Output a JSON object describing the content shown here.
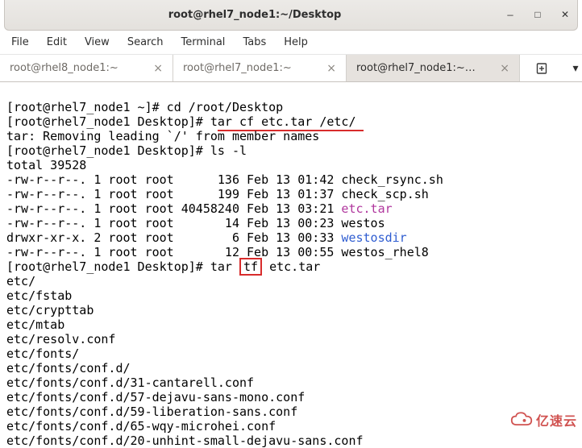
{
  "window": {
    "title": "root@rhel7_node1:~/Desktop"
  },
  "menu": {
    "file": "File",
    "edit": "Edit",
    "view": "View",
    "search": "Search",
    "terminal": "Terminal",
    "tabs": "Tabs",
    "help": "Help"
  },
  "tabs": [
    {
      "label": "root@rhel8_node1:~"
    },
    {
      "label": "root@rhel7_node1:~"
    },
    {
      "label": "root@rhel7_node1:~…"
    }
  ],
  "term": {
    "l1a": "[root@rhel7_node1 ~]# cd /root/Desktop",
    "l2a": "[root@rhel7_node1 Desktop]# t",
    "l2b": "ar cf etc.tar /etc/ ",
    "l3": "tar: Removing leading `/' from member names",
    "l4": "[root@rhel7_node1 Desktop]# ls -l",
    "l5": "total 39528",
    "l6": "-rw-r--r--. 1 root root      136 Feb 13 01:42 check_rsync.sh",
    "l7": "-rw-r--r--. 1 root root      199 Feb 13 01:37 check_scp.sh",
    "l8a": "-rw-r--r--. 1 root root 40458240 Feb 13 03:21 ",
    "l8b": "etc.tar",
    "l9": "-rw-r--r--. 1 root root       14 Feb 13 00:23 westos",
    "l10a": "drwxr-xr-x. 2 root root        6 Feb 13 00:33 ",
    "l10b": "westosdir",
    "l11": "-rw-r--r--. 1 root root       12 Feb 13 00:55 westos_rhel8",
    "l12a": "[root@rhel7_node1 Desktop]# tar ",
    "l12b": "tf",
    "l12c": " etc.tar",
    "l13": "etc/",
    "l14": "etc/fstab",
    "l15": "etc/crypttab",
    "l16": "etc/mtab",
    "l17": "etc/resolv.conf",
    "l18": "etc/fonts/",
    "l19": "etc/fonts/conf.d/",
    "l20": "etc/fonts/conf.d/31-cantarell.conf",
    "l21": "etc/fonts/conf.d/57-dejavu-sans-mono.conf",
    "l22": "etc/fonts/conf.d/59-liberation-sans.conf",
    "l23": "etc/fonts/conf.d/65-wqy-microhei.conf",
    "l24": "etc/fonts/conf.d/20-unhint-small-dejavu-sans.conf"
  },
  "watermark": {
    "text": "亿速云"
  }
}
